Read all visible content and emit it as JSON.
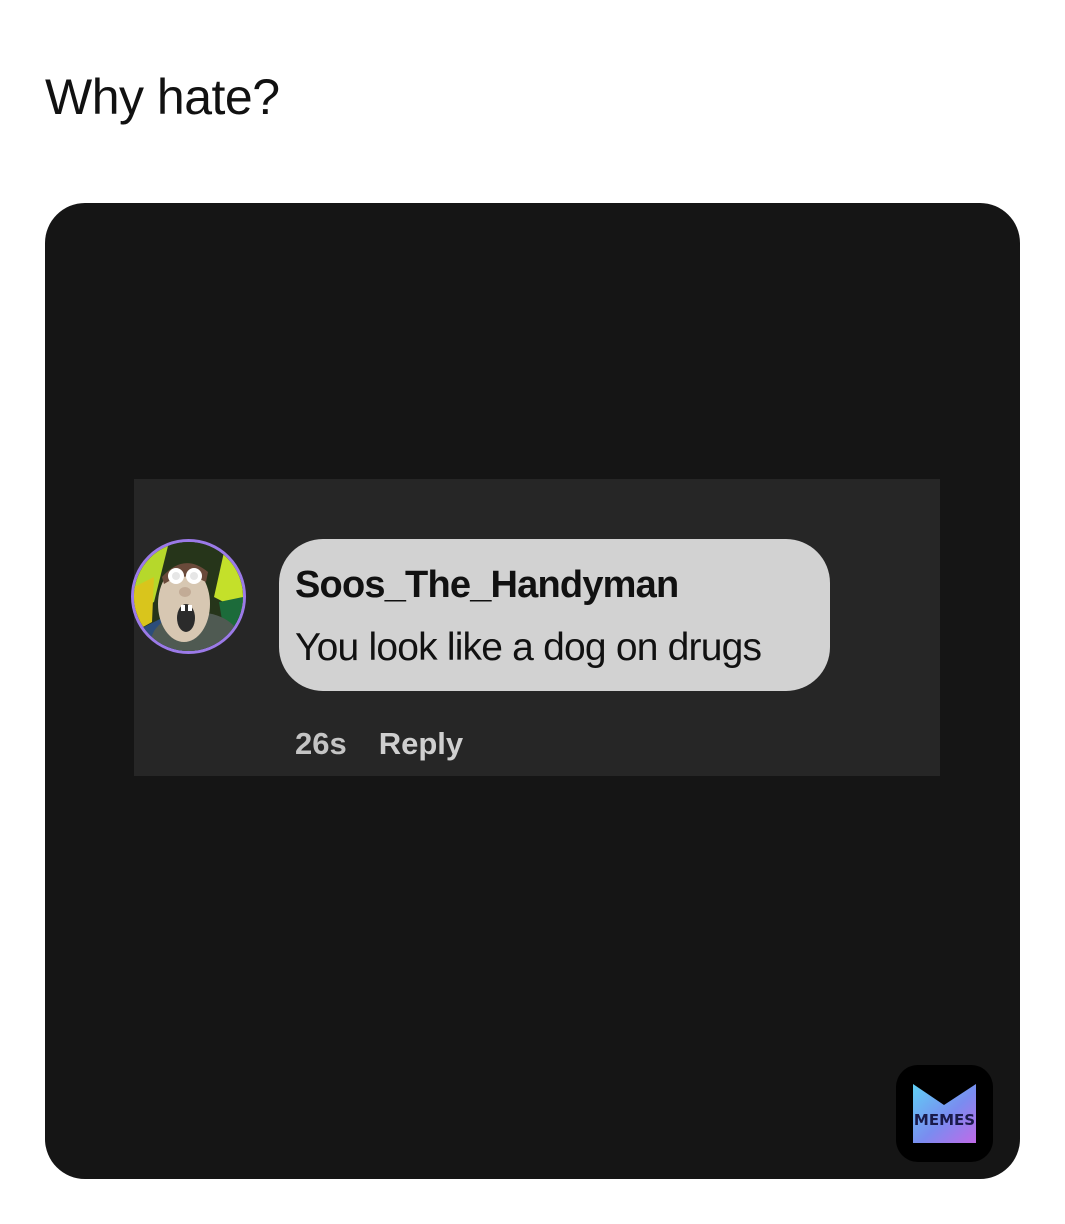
{
  "caption": "Why hate?",
  "comment": {
    "username": "Soos_The_Handyman",
    "text": "You look like a dog on drugs",
    "time": "26s",
    "reply_label": "Reply",
    "avatar_icon": "cartoon-face-avatar"
  },
  "watermark": {
    "label": "MEMES",
    "icon": "memes-logo-icon"
  },
  "colors": {
    "page_background": "#ffffff",
    "card_background": "#151515",
    "comment_box_background": "#262626",
    "bubble_background": "#d2d2d2",
    "avatar_ring": "#9b7ae8"
  }
}
